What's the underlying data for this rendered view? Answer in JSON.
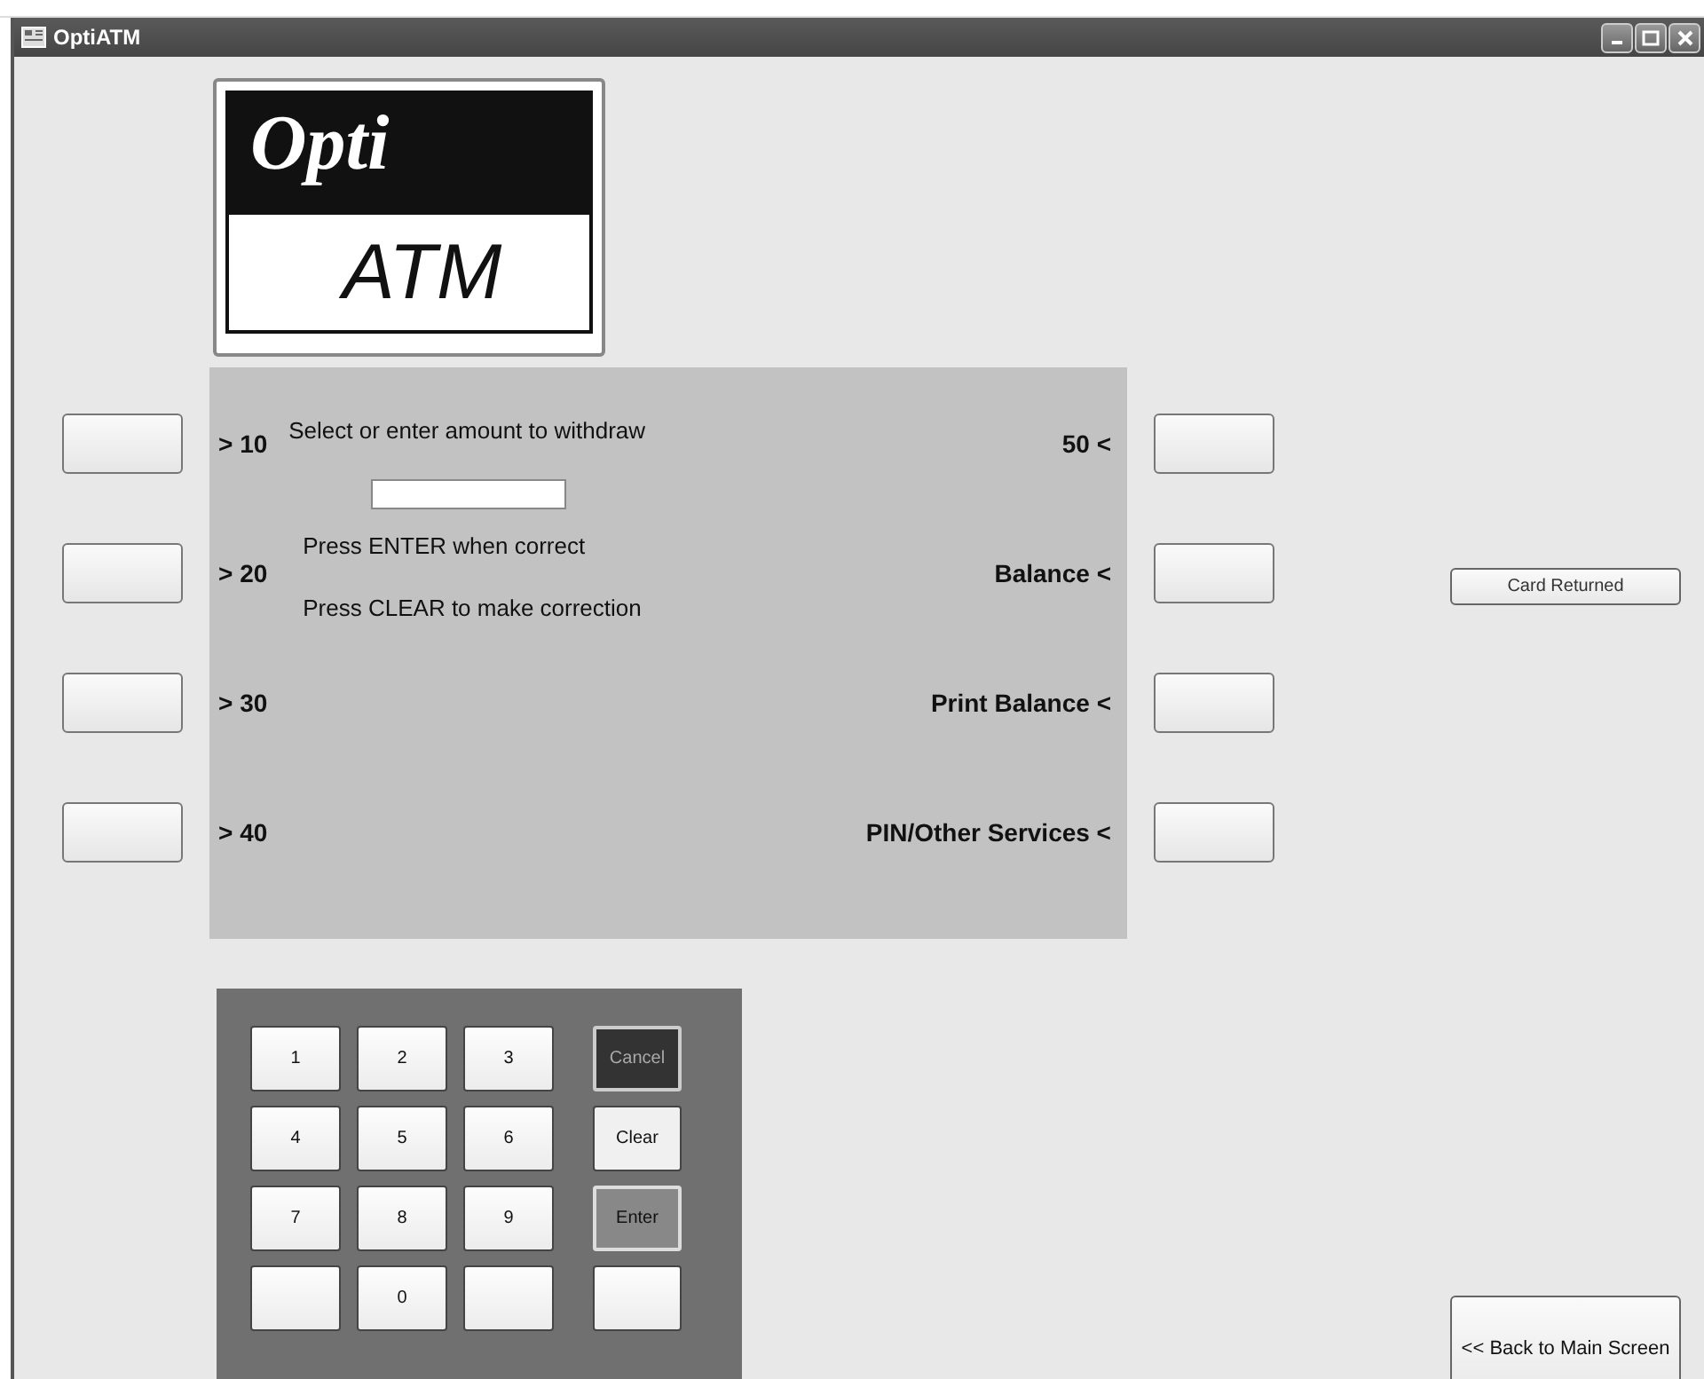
{
  "window": {
    "title": "OptiATM"
  },
  "logo": {
    "top": "Opti",
    "bottom": "ATM"
  },
  "left_options": [
    {
      "label": "> 10"
    },
    {
      "label": "> 20"
    },
    {
      "label": "> 30"
    },
    {
      "label": "> 40"
    }
  ],
  "right_options": [
    {
      "label": "50 <"
    },
    {
      "label": "Balance <"
    },
    {
      "label": "Print Balance <"
    },
    {
      "label": "PIN/Other Services <"
    }
  ],
  "prompt": {
    "heading": "Select or enter amount to withdraw",
    "hints": [
      "Press ENTER when correct",
      "Press CLEAR to make correction"
    ]
  },
  "card_button": "Card Returned",
  "keypad": [
    {
      "kind": "digit",
      "label": "1"
    },
    {
      "kind": "digit",
      "label": "2"
    },
    {
      "kind": "digit",
      "label": "3"
    },
    {
      "kind": "cancel",
      "label": "Cancel"
    },
    {
      "kind": "digit",
      "label": "4"
    },
    {
      "kind": "digit",
      "label": "5"
    },
    {
      "kind": "digit",
      "label": "6"
    },
    {
      "kind": "clear",
      "label": "Clear"
    },
    {
      "kind": "digit",
      "label": "7"
    },
    {
      "kind": "digit",
      "label": "8"
    },
    {
      "kind": "digit",
      "label": "9"
    },
    {
      "kind": "enter",
      "label": "Enter"
    },
    {
      "kind": "blank"
    },
    {
      "kind": "digit",
      "label": "0"
    },
    {
      "kind": "blank"
    },
    {
      "kind": "blank"
    }
  ],
  "back_button": "<< Back to Main Screen"
}
